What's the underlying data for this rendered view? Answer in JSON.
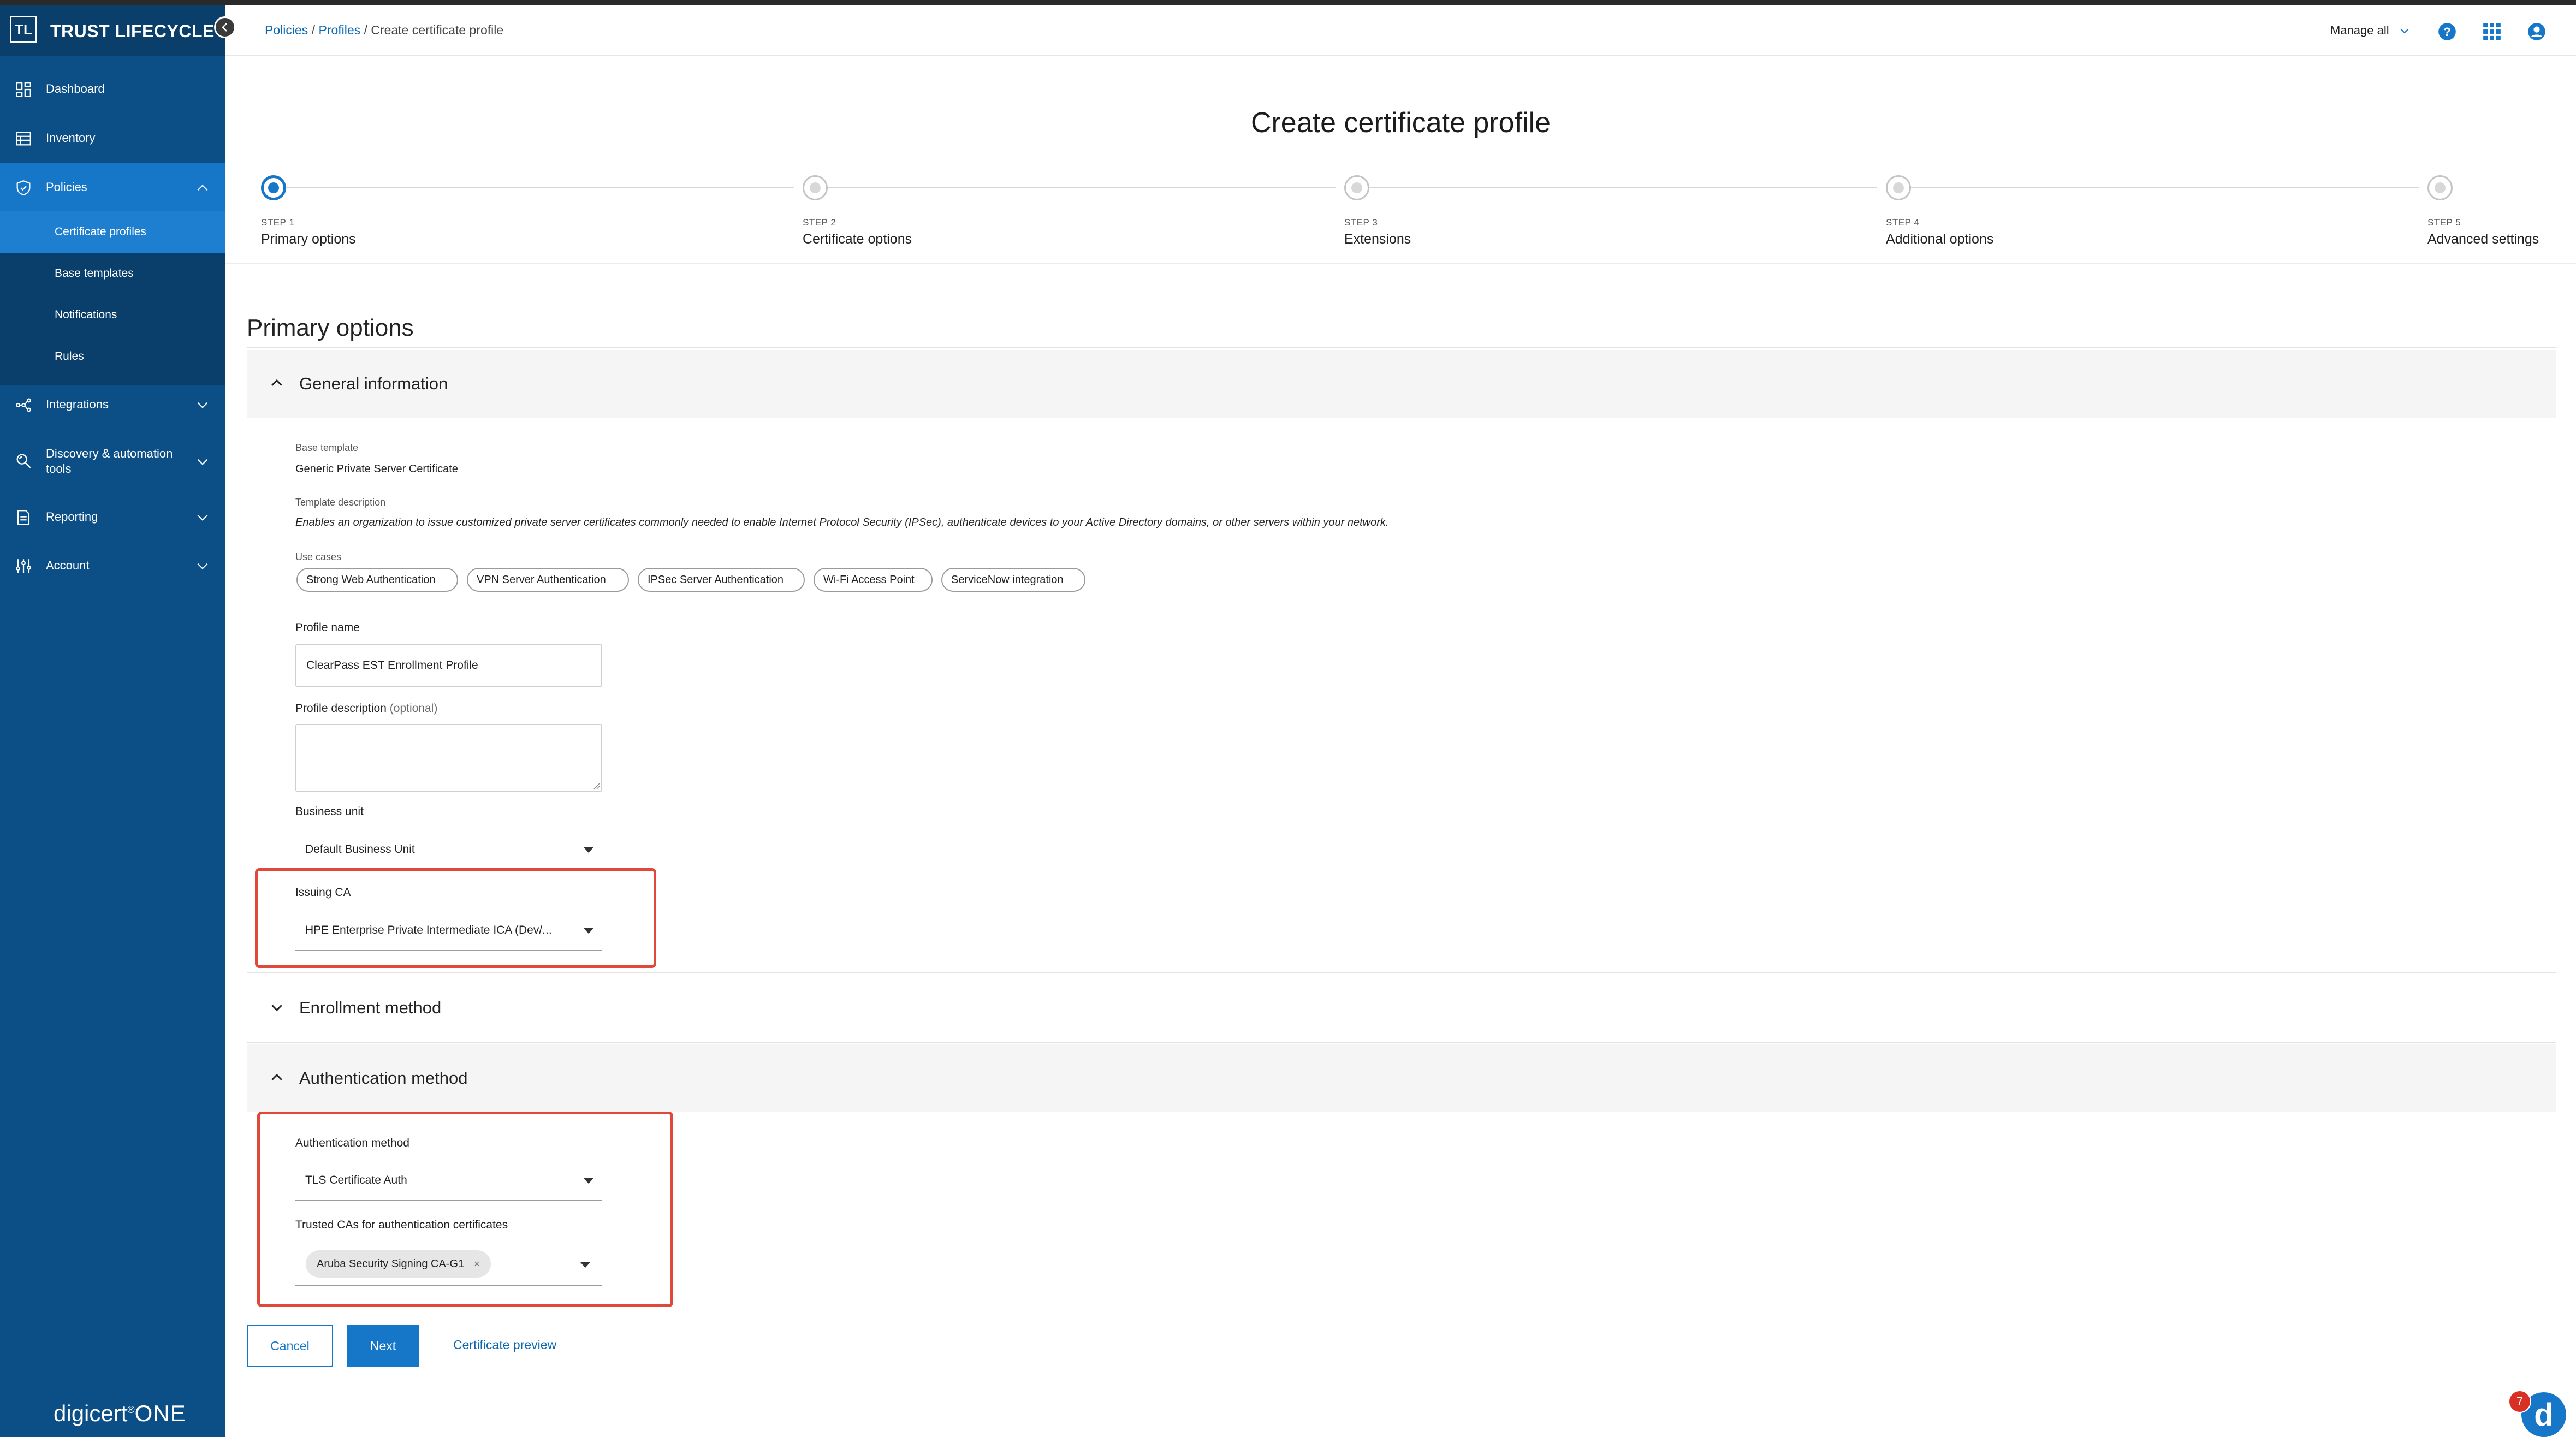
{
  "app": {
    "brand_abbr": "TL",
    "brand_name": "TRUST LIFECYCLE",
    "footer_brand": "digicert",
    "footer_brand_suffix": "ONE"
  },
  "sidebar": {
    "items": [
      {
        "label": "Dashboard",
        "icon": "dashboard-icon"
      },
      {
        "label": "Inventory",
        "icon": "inventory-icon"
      },
      {
        "label": "Policies",
        "icon": "shield-icon"
      },
      {
        "label": "Integrations",
        "icon": "integrations-icon"
      },
      {
        "label": "Discovery & automation tools",
        "icon": "discovery-icon"
      },
      {
        "label": "Reporting",
        "icon": "report-icon"
      },
      {
        "label": "Account",
        "icon": "sliders-icon"
      }
    ],
    "policies_sub": [
      "Certificate profiles",
      "Base templates",
      "Notifications",
      "Rules"
    ]
  },
  "header": {
    "breadcrumb": [
      "Policies",
      "Profiles",
      "Create certificate profile"
    ],
    "breadcrumb_sep": " / ",
    "manage": "Manage all"
  },
  "page": {
    "title": "Create certificate profile"
  },
  "stepper": [
    {
      "num": "STEP 1",
      "label": "Primary options",
      "active": true
    },
    {
      "num": "STEP 2",
      "label": "Certificate options",
      "active": false
    },
    {
      "num": "STEP 3",
      "label": "Extensions",
      "active": false
    },
    {
      "num": "STEP 4",
      "label": "Additional options",
      "active": false
    },
    {
      "num": "STEP 5",
      "label": "Advanced settings",
      "active": false
    }
  ],
  "section": {
    "title": "Primary options"
  },
  "general": {
    "title": "General information",
    "base_template_label": "Base template",
    "base_template_value": "Generic Private Server Certificate",
    "template_desc_label": "Template description",
    "template_desc_value": "Enables an organization to issue customized private server certificates commonly needed to enable Internet Protocol Security (IPSec), authenticate devices to your Active Directory domains, or other servers within your network.",
    "use_cases_label": "Use cases",
    "use_cases": [
      "Strong Web Authentication",
      "VPN Server Authentication",
      "IPSec Server Authentication",
      "Wi-Fi Access Point",
      "ServiceNow integration"
    ],
    "profile_name_label": "Profile name",
    "profile_name_value": "ClearPass EST Enrollment Profile",
    "profile_desc_label": "Profile description",
    "profile_desc_optional": "(optional)",
    "profile_desc_value": "",
    "business_unit_label": "Business unit",
    "business_unit_value": "Default Business Unit",
    "issuing_ca_label": "Issuing CA",
    "issuing_ca_value": "HPE Enterprise Private Intermediate ICA (Dev/..."
  },
  "enrollment": {
    "title": "Enrollment method"
  },
  "auth": {
    "title": "Authentication method",
    "method_label": "Authentication method",
    "method_value": "TLS Certificate Auth",
    "trusted_label": "Trusted CAs for authentication certificates",
    "trusted_chip": "Aruba Security Signing CA-G1",
    "chip_remove": "×"
  },
  "actions": {
    "cancel": "Cancel",
    "next": "Next",
    "preview": "Certificate preview"
  },
  "help": {
    "badge": "7",
    "letter": "d"
  },
  "colors": {
    "sidebar": "#0c4f86",
    "accent": "#1677c9",
    "highlight": "#e0483a"
  }
}
